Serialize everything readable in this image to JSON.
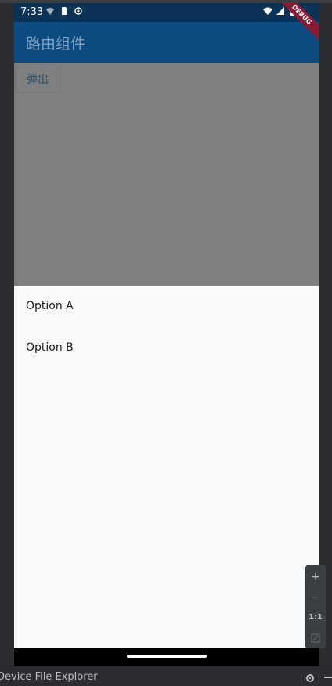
{
  "status_bar": {
    "time": "7:33",
    "left_icons": [
      "wifi-question-icon",
      "sim-card-icon",
      "target-icon"
    ],
    "right_icons": [
      "wifi-icon",
      "signal-icon",
      "battery-icon"
    ]
  },
  "app_bar": {
    "title": "路由组件"
  },
  "content": {
    "popup_button_label": "弹出"
  },
  "bottom_sheet": {
    "options": [
      "Option A",
      "Option B"
    ]
  },
  "debug_banner": {
    "label": "DEBUG"
  },
  "emulator_zoom": {
    "zoom_in": "+",
    "zoom_out": "−",
    "actual_size": "1:1",
    "fit_icon": "fit-screen-icon"
  },
  "ide_panel": {
    "title": "Device File Explorer"
  },
  "colors": {
    "status_bar": "#0b3356",
    "app_bar": "#0d4a7f",
    "scrim": "#7f7f7f",
    "sheet": "#fafafa",
    "debug_banner": "#8a1a30"
  }
}
